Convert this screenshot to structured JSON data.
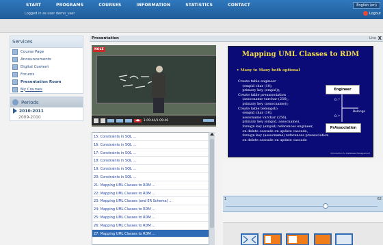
{
  "nav": {
    "items": [
      "START",
      "PROGRAMS",
      "COURSES",
      "INFORMATION",
      "STATISTICS",
      "CONTACT"
    ],
    "logged_in": "Logged in as user demo_user",
    "language": "English (en)",
    "logout": "Logout"
  },
  "sidebar": {
    "services_title": "Services",
    "services": [
      {
        "label": "Course Page",
        "icon": "page-icon"
      },
      {
        "label": "Announcements",
        "icon": "announce-icon"
      },
      {
        "label": "Digital Content",
        "icon": "content-icon"
      },
      {
        "label": "Forums",
        "icon": "forum-icon"
      },
      {
        "label": "Presentation Room",
        "icon": "presentation-icon"
      },
      {
        "label": "My Courses",
        "icon": "courses-icon"
      }
    ],
    "periods_title": "Periods",
    "periods": [
      "2010-2011",
      "2009-2010"
    ]
  },
  "panel": {
    "title": "Presentation",
    "live": "Live",
    "close": "X"
  },
  "video": {
    "badge": "NOLE",
    "time": "1:09:44/1:09:46"
  },
  "slide": {
    "title": "Mapping UML  Classes to RDM",
    "bullet": "Many to Many both optional",
    "code": "Create table engineer\n    (empid char (10),\n    primary key (empid));\nCreate table preassociation\n    (assocname varchar (256),\n    primary key (assocname));\nCreate table belongsto\n    (empid char (10),\n    assocname varchar (256),\n    primary key (empid, assocname),\n    foreign key (empid) references engineer,\n    on delete cascade on update cascade,\n    foreign key (assocname) references prassociation\n    on delete cascade on update cascade",
    "box_engineer": "Engineer",
    "box_assoc": "PrAssociation",
    "label_belongs": "Belongs",
    "mult_top": "0..*",
    "mult_bottom": "0..*",
    "footer": "Introduction to Database Management"
  },
  "chapters": {
    "items": [
      "15: Constraints in SQL ...",
      "16: Constraints in SQL ...",
      "17: Constraints in SQL ...",
      "18: Constraints in SQL ...",
      "19: Constraints in SQL ...",
      "20: Constraints in SQL ...",
      "21: Mapping UML Classes to RDM ...",
      "22: Mapping UML Classes to RDM ...",
      "23: Mapping UML Classes (and ER Schema) ...",
      "24: Mapping UML Classes to RDM ...",
      "25: Mapping UML Classes to RDM ...",
      "26: Mapping UML Classes to RDM ...",
      "27: Mapping UML  Classes to RDM ..."
    ],
    "selected_index": 12
  },
  "timeline": {
    "start": "1",
    "end": "62"
  },
  "colors": {
    "nav_bg": "#2f78bd",
    "slide_bg": "#0b0b78",
    "slide_title": "#f1d94a",
    "selected": "#2e6bb7",
    "layout_orange": "#f07d1a"
  }
}
